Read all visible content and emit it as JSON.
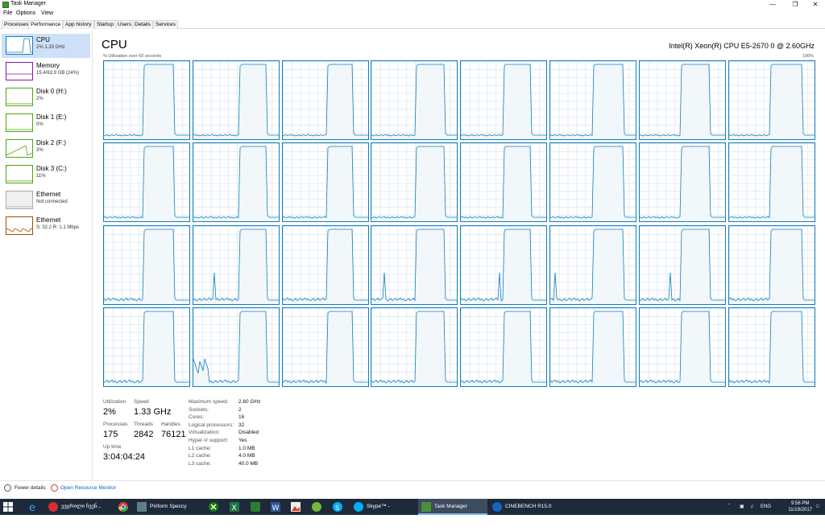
{
  "window": {
    "title": "Task Manager"
  },
  "menu": [
    "File",
    "Options",
    "View"
  ],
  "tabs": [
    "Processes",
    "Performance",
    "App history",
    "Startup",
    "Users",
    "Details",
    "Services"
  ],
  "sidebar": [
    {
      "name": "CPU",
      "sub": "2% 1.33 GHz",
      "color": "#117dbb"
    },
    {
      "name": "Memory",
      "sub": "15.4/63.9 GB (24%)",
      "color": "#8b12ae"
    },
    {
      "name": "Disk 0 (H:)",
      "sub": "2%",
      "color": "#4da60c"
    },
    {
      "name": "Disk 1 (E:)",
      "sub": "0%",
      "color": "#4da60c"
    },
    {
      "name": "Disk 2 (F:)",
      "sub": "3%",
      "color": "#4da60c"
    },
    {
      "name": "Disk 3 (C:)",
      "sub": "11%",
      "color": "#4da60c"
    },
    {
      "name": "Ethernet",
      "sub": "Not connected",
      "color": "#aaaaaa"
    },
    {
      "name": "Ethernet",
      "sub": "S: 32.2 R: 1.1 Mbps",
      "color": "#a74f01"
    }
  ],
  "main": {
    "title": "CPU",
    "model": "Intel(R) Xeon(R) CPU E5-2670 0 @ 2.60GHz",
    "util_label": "% Utilization over 60 seconds",
    "max_label": "100%",
    "graph_color": "#117dbb",
    "graph_fill": "#f1f6fa"
  },
  "stats": {
    "utilization_label": "Utilization",
    "utilization": "2%",
    "speed_label": "Speed",
    "speed": "1.33 GHz",
    "processes_label": "Processes",
    "processes": "175",
    "threads_label": "Threads",
    "threads": "2842",
    "handles_label": "Handles",
    "handles": "76121",
    "uptime_label": "Up time",
    "uptime": "3:04:04:24"
  },
  "specs": [
    {
      "k": "Maximum speed:",
      "v": "2.60 GHz"
    },
    {
      "k": "Sockets:",
      "v": "2"
    },
    {
      "k": "Cores:",
      "v": "16"
    },
    {
      "k": "Logical processors:",
      "v": "32"
    },
    {
      "k": "Virtualization:",
      "v": "Disabled"
    },
    {
      "k": "Hyper-V support:",
      "v": "Yes"
    },
    {
      "k": "L1 cache:",
      "v": "1.0 MB"
    },
    {
      "k": "L2 cache:",
      "v": "4.0 MB"
    },
    {
      "k": "L3 cache:",
      "v": "40.0 MB"
    }
  ],
  "footer": {
    "fewer": "Fewer details",
    "monitor": "Open Resource Monitor"
  },
  "taskbar": {
    "apps": [
      {
        "label": "ვეცრილი ჩვენ...",
        "color": "#d32f2f"
      },
      {
        "label": "Piriform Speccy",
        "color": "#444"
      },
      {
        "label": "Skype™ - mamuka...",
        "color": "#00aff0"
      },
      {
        "label": "Task Manager",
        "color": "#4a8f3a"
      },
      {
        "label": "CINEBENCH R15.0",
        "color": "#1565c0"
      }
    ],
    "lang": "ENG",
    "time": "9:56 PM",
    "date": "11/19/2017"
  }
}
